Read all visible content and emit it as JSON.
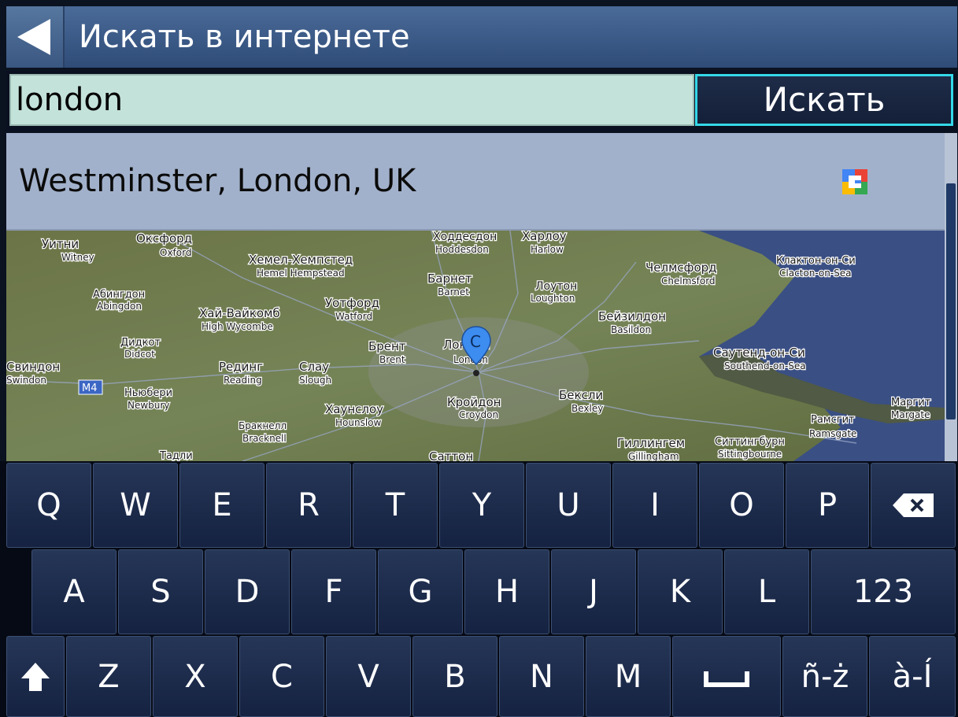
{
  "header": {
    "title": "Искать в интернете",
    "back_icon": "back-arrow-icon"
  },
  "search": {
    "value": "london",
    "button_label": "Искать",
    "accent_color": "#34d8e8"
  },
  "results": [
    {
      "label": "Westminster, London, UK",
      "provider_icon": "google-logo-icon"
    }
  ],
  "map": {
    "pin_label": "C",
    "places": [
      {
        "ru": "Уитни",
        "en": "Witney"
      },
      {
        "ru": "Оксфорд",
        "en": "Oxford"
      },
      {
        "ru": "Хемел-Хемпстед",
        "en": "Hemel Hempstead"
      },
      {
        "ru": "Ходдесдон",
        "en": "Hoddesdon"
      },
      {
        "ru": "Харлоу",
        "en": "Harlow"
      },
      {
        "ru": "Челмсфорд",
        "en": "Chelmsford"
      },
      {
        "ru": "Клактон-он-Си",
        "en": "Clacton-on-Sea"
      },
      {
        "ru": "Абингдон",
        "en": "Abingdon"
      },
      {
        "ru": "Барнет",
        "en": "Barnet"
      },
      {
        "ru": "Лоутон",
        "en": "Loughton"
      },
      {
        "ru": "Уотфорд",
        "en": "Watford"
      },
      {
        "ru": "Хай-Вайкомб",
        "en": "High Wycombe"
      },
      {
        "ru": "Бейзилдон",
        "en": "Basildon"
      },
      {
        "ru": "Дидкот",
        "en": "Didcot"
      },
      {
        "ru": "Брент",
        "en": "Brent"
      },
      {
        "ru": "Лондон",
        "en": "London"
      },
      {
        "ru": "Саутенд-он-Си",
        "en": "Southend-on-Sea"
      },
      {
        "ru": "Свиндон",
        "en": "Swindon"
      },
      {
        "ru": "Рединг",
        "en": "Reading"
      },
      {
        "ru": "Слау",
        "en": "Slough"
      },
      {
        "ru": "Ньюбери",
        "en": "Newbury"
      },
      {
        "ru": "Кройдон",
        "en": "Croydon"
      },
      {
        "ru": "Бексли",
        "en": "Bexley"
      },
      {
        "ru": "Маргит",
        "en": "Margate"
      },
      {
        "ru": "Хаунслоу",
        "en": "Hounslow"
      },
      {
        "ru": "Рамсгит",
        "en": "Ramsgate"
      },
      {
        "ru": "Бракнелл",
        "en": "Bracknell"
      },
      {
        "ru": "Гиллингем",
        "en": "Gillingham"
      },
      {
        "ru": "Ситтингбурн",
        "en": "Sittingbourne"
      },
      {
        "ru": "Тадли",
        "en": ""
      },
      {
        "ru": "Саттон",
        "en": ""
      }
    ],
    "road_badge": "M4"
  },
  "keyboard": {
    "row1": [
      "Q",
      "W",
      "E",
      "R",
      "T",
      "Y",
      "U",
      "I",
      "O",
      "P"
    ],
    "row2": [
      "A",
      "S",
      "D",
      "F",
      "G",
      "H",
      "J",
      "K",
      "L"
    ],
    "numbers_label": "123",
    "row3": [
      "Z",
      "X",
      "C",
      "V",
      "B",
      "N",
      "M"
    ],
    "accent1_label": "ñ-ż",
    "accent2_label": "à-Í",
    "backspace_icon": "backspace-icon",
    "shift_icon": "shift-arrow-icon",
    "space_icon": "space-bar-icon"
  }
}
